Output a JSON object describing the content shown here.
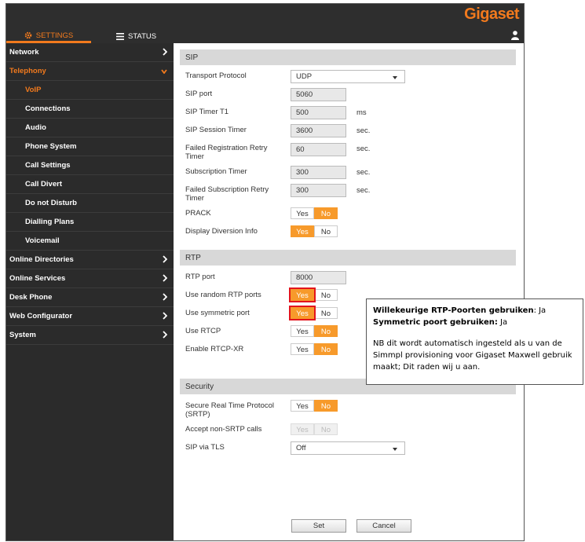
{
  "brand": "Gigaset",
  "tabs": {
    "settings": "SETTINGS",
    "status": "STATUS"
  },
  "sidebar": {
    "items": [
      {
        "label": "Network"
      },
      {
        "label": "Telephony"
      },
      {
        "label": "VoIP"
      },
      {
        "label": "Connections"
      },
      {
        "label": "Audio"
      },
      {
        "label": "Phone System"
      },
      {
        "label": "Call Settings"
      },
      {
        "label": "Call Divert"
      },
      {
        "label": "Do not Disturb"
      },
      {
        "label": "Dialling Plans"
      },
      {
        "label": "Voicemail"
      },
      {
        "label": "Online Directories"
      },
      {
        "label": "Online Services"
      },
      {
        "label": "Desk Phone"
      },
      {
        "label": "Web Configurator"
      },
      {
        "label": "System"
      }
    ]
  },
  "sip": {
    "title": "SIP",
    "transport_protocol": {
      "label": "Transport Protocol",
      "value": "UDP"
    },
    "sip_port": {
      "label": "SIP port",
      "value": "5060"
    },
    "sip_timer_t1": {
      "label": "SIP Timer T1",
      "value": "500",
      "unit": "ms"
    },
    "sip_session_timer": {
      "label": "SIP Session Timer",
      "value": "3600",
      "unit": "sec."
    },
    "failed_registration_retry_timer": {
      "label": "Failed Registration Retry Timer",
      "value": "60",
      "unit": "sec."
    },
    "subscription_timer": {
      "label": "Subscription Timer",
      "value": "300",
      "unit": "sec."
    },
    "failed_subscription_retry_timer": {
      "label": "Failed Subscription Retry Timer",
      "value": "300",
      "unit": "sec."
    },
    "prack": {
      "label": "PRACK",
      "selected": "No"
    },
    "display_diversion_info": {
      "label": "Display Diversion Info",
      "selected": "Yes"
    }
  },
  "rtp": {
    "title": "RTP",
    "rtp_port": {
      "label": "RTP port",
      "value": "8000"
    },
    "use_random_rtp_ports": {
      "label": "Use random RTP ports",
      "selected": "Yes"
    },
    "use_symmetric_port": {
      "label": "Use symmetric port",
      "selected": "Yes"
    },
    "use_rtcp": {
      "label": "Use RTCP",
      "selected": "No"
    },
    "enable_rtcp_xr": {
      "label": "Enable RTCP-XR",
      "selected": "No"
    }
  },
  "security": {
    "title": "Security",
    "srtp": {
      "label": "Secure Real Time Protocol (SRTP)",
      "selected": "No"
    },
    "accept_non_srtp": {
      "label": "Accept non-SRTP calls",
      "selected": ""
    },
    "sip_via_tls": {
      "label": "SIP via TLS",
      "value": "Off"
    }
  },
  "toggle_labels": {
    "yes": "Yes",
    "no": "No"
  },
  "actions": {
    "set": "Set",
    "cancel": "Cancel"
  },
  "note": {
    "line1_bold": "Willekeurige RTP-Poorten gebruiken",
    "line1_rest": ": Ja",
    "line2_bold": "Symmetric poort gebruiken:",
    "line2_rest": " Ja",
    "paragraph": "NB dit wordt automatisch ingesteld als u van de Simmpl provisioning voor Gigaset Maxwell gebruik maakt; Dit raden wij u aan."
  },
  "colors": {
    "accent": "#f27a1d",
    "toggle_on": "#f79a2b",
    "highlight": "#e3141c",
    "sidebar_bg": "#2b2b2b"
  }
}
